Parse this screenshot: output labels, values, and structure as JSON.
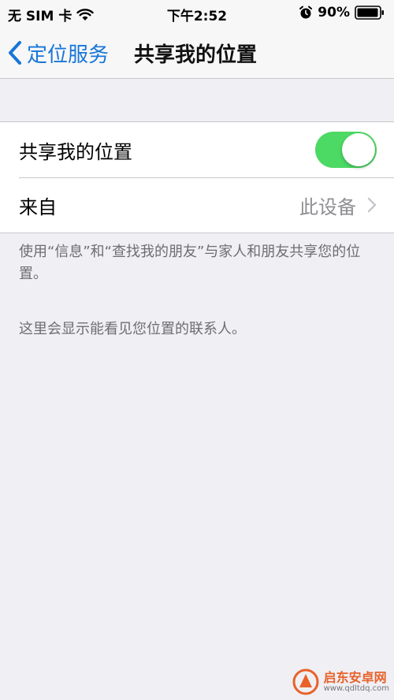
{
  "status_bar": {
    "carrier": "无 SIM 卡",
    "time": "下午2:52",
    "battery": "90%"
  },
  "nav": {
    "back_label": "定位服务",
    "title": "共享我的位置"
  },
  "settings": {
    "share_location_label": "共享我的位置",
    "share_location_on": true,
    "from_label": "来自",
    "from_value": "此设备"
  },
  "footer": {
    "share_note": "使用“信息”和“查找我的朋友”与家人和朋友共享您的位置。",
    "contacts_note": "这里会显示能看见您位置的联系人。"
  },
  "watermark": {
    "title": "启东安卓网",
    "url": "www.qdltdq.com"
  },
  "colors": {
    "accent": "#1776d8",
    "toggle_on": "#4cd964",
    "background": "#efeff4"
  }
}
